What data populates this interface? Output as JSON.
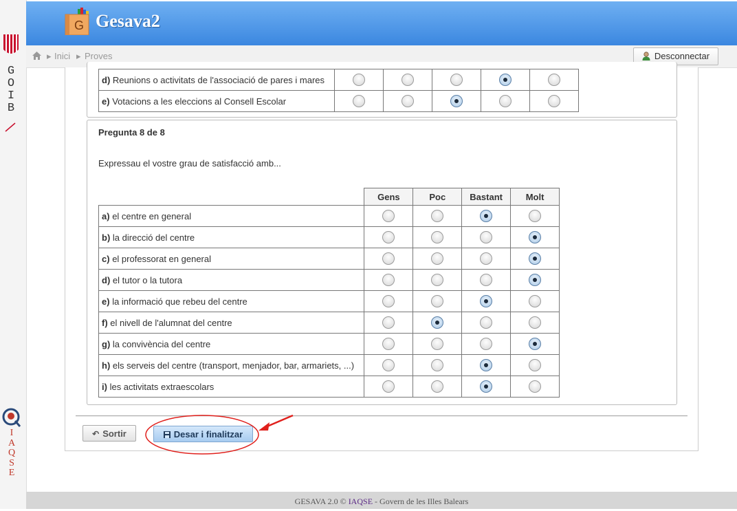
{
  "sidebar": {
    "brand_letters": [
      "G",
      "O",
      "I",
      "B"
    ],
    "agency_letters": [
      "I",
      "A",
      "Q",
      "S",
      "E"
    ]
  },
  "header": {
    "logo_letter": "G",
    "app_title": "Gesava2"
  },
  "breadcrumb": {
    "home_icon": "home-icon",
    "items": [
      "Inici",
      "Proves"
    ]
  },
  "user": {
    "logout_label": "Desconnectar",
    "logout_icon": "user-icon"
  },
  "prev_question": {
    "rows": [
      {
        "key": "d)",
        "label": "Reunions o activitats de l'associació de pares i mares",
        "selected": 3
      },
      {
        "key": "e)",
        "label": "Votacions a les eleccions al Consell Escolar",
        "selected": 2
      }
    ]
  },
  "question": {
    "title": "Pregunta 8 de 8",
    "prompt": "Expressau el vostre grau de satisfacció amb...",
    "columns": [
      "Gens",
      "Poc",
      "Bastant",
      "Molt"
    ],
    "rows": [
      {
        "key": "a)",
        "label": "el centre en general",
        "selected": 2
      },
      {
        "key": "b)",
        "label": "la direcció del centre",
        "selected": 3
      },
      {
        "key": "c)",
        "label": "el professorat en general",
        "selected": 3
      },
      {
        "key": "d)",
        "label": "el tutor o la tutora",
        "selected": 3
      },
      {
        "key": "e)",
        "label": "la informació que rebeu del centre",
        "selected": 2
      },
      {
        "key": "f)",
        "label": "el nivell de l'alumnat del centre",
        "selected": 1
      },
      {
        "key": "g)",
        "label": "la convivència del centre",
        "selected": 3
      },
      {
        "key": "h)",
        "label": "els serveis del centre (transport, menjador, bar, armariets, ...)",
        "selected": 2
      },
      {
        "key": "i)",
        "label": "les activitats extraescolars",
        "selected": 2
      }
    ]
  },
  "actions": {
    "back_label": "Sortir",
    "back_icon": "undo-arrow-icon",
    "save_label": "Desar i finalitzar",
    "save_icon": "floppy-disk-icon"
  },
  "footer": {
    "prefix": "GESAVA 2.0 © ",
    "link": "IAQSE",
    "suffix": " - Govern de les Illes Balears"
  },
  "colors": {
    "header_top": "#6fb0f2",
    "header_bottom": "#3b87e0",
    "annotation": "#e0201c"
  }
}
